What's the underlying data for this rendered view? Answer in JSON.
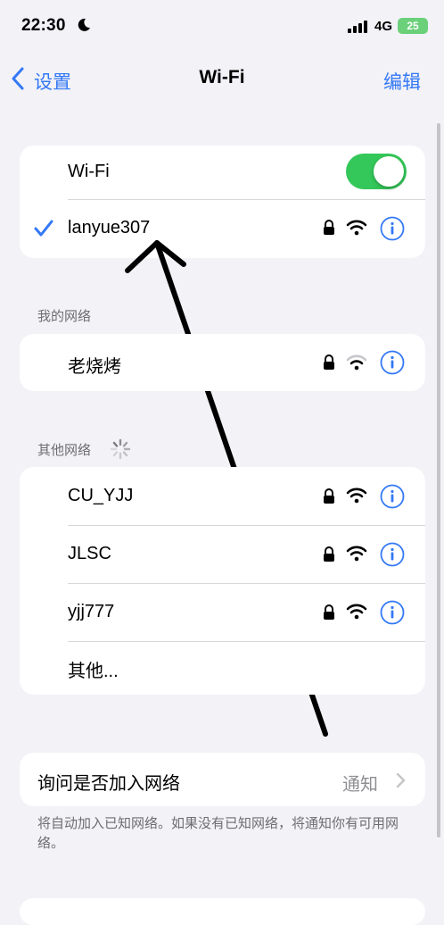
{
  "status_bar": {
    "time": "22:30",
    "network": "4G",
    "battery": "25"
  },
  "nav": {
    "back_label": "设置",
    "title": "Wi-Fi",
    "edit_label": "编辑"
  },
  "current": {
    "wifi_label": "Wi-Fi",
    "wifi_on": true,
    "connected_name": "lanyue307"
  },
  "my_networks": {
    "header": "我的网络",
    "items": [
      {
        "name": "老烧烤"
      }
    ]
  },
  "other_networks": {
    "header": "其他网络",
    "items": [
      {
        "name": "CU_YJJ"
      },
      {
        "name": "JLSC"
      },
      {
        "name": "yjj777"
      }
    ],
    "other_label": "其他..."
  },
  "ask_join": {
    "label": "询问是否加入网络",
    "value": "通知"
  },
  "footer_note": "将自动加入已知网络。如果没有已知网络，将通知你有可用网络。",
  "colors": {
    "accent": "#3478f6",
    "toggle_on": "#34c759",
    "background": "#f2f2f7"
  }
}
